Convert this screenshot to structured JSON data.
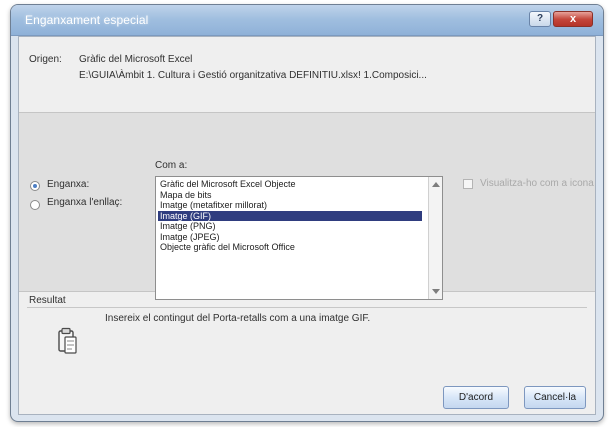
{
  "window": {
    "title": "Enganxament especial"
  },
  "controls": {
    "help": "?",
    "close": "x"
  },
  "origin": {
    "label": "Origen:",
    "value": "Gràfic del Microsoft Excel",
    "path": "E:\\GUIA\\Àmbit 1. Cultura i Gestió organitzativa DEFINITIU.xlsx! 1.Composici..."
  },
  "paste_options": {
    "paste": "Enganxa:",
    "paste_link": "Enganxa l'enllaç:"
  },
  "as_section": {
    "label": "Com a:",
    "items": [
      "Gràfic del Microsoft Excel Objecte",
      "Mapa de bits",
      "Imatge (metafitxer millorat)",
      "Imatge (GIF)",
      "Imatge (PNG)",
      "Imatge (JPEG)",
      "Objecte gràfic del Microsoft Office"
    ],
    "selected_index": 3
  },
  "display_option": {
    "label": "Visualitza-ho com a icona"
  },
  "result": {
    "label": "Resultat",
    "text": "Insereix el contingut del Porta-retalls com a una imatge GIF."
  },
  "buttons": {
    "ok": "D'acord",
    "cancel": "Cancel·la"
  },
  "icons": {
    "paste": "clipboard-icon",
    "help": "help-icon",
    "close": "close-icon"
  },
  "colors": {
    "title_gradient_top": "#bfd3ea",
    "title_gradient_bottom": "#8fb1d8",
    "selected_item": "#2f3d7f",
    "close_button": "#c4463b"
  }
}
